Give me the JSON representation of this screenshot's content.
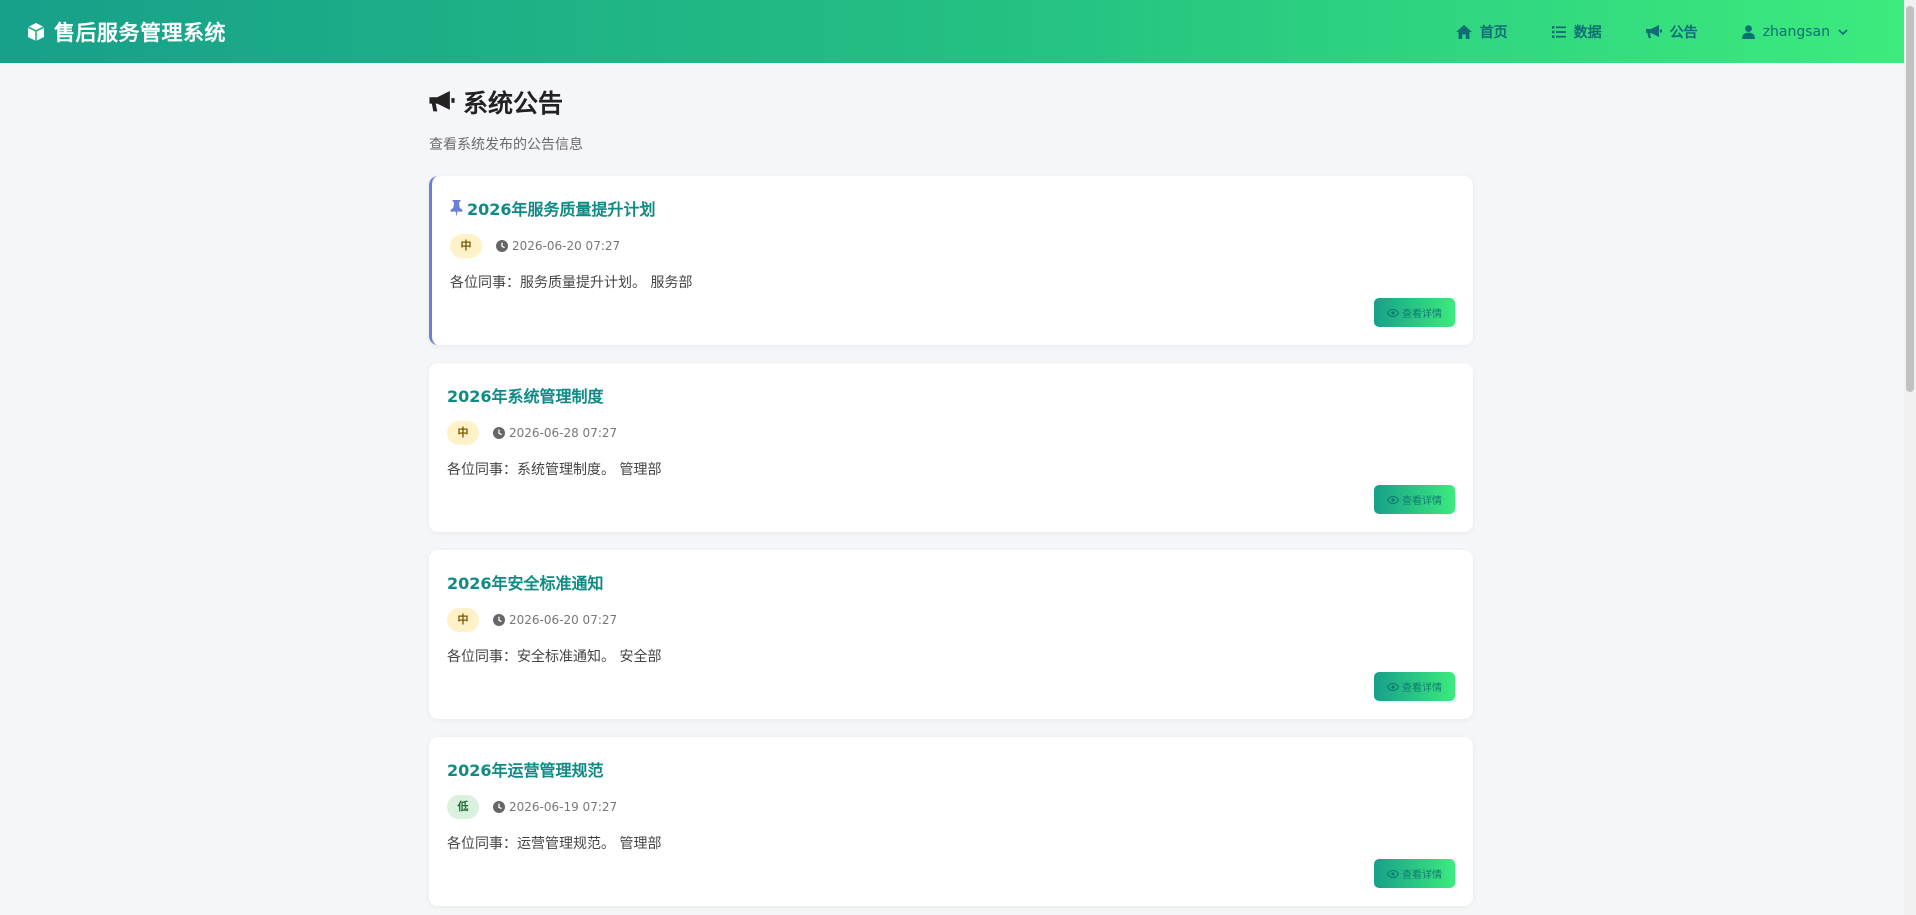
{
  "app": {
    "title": "售后服务管理系统"
  },
  "nav": {
    "home": "首页",
    "data": "数据",
    "announcement": "公告",
    "user": "zhangsan"
  },
  "page": {
    "title": "系统公告",
    "subtitle": "查看系统发布的公告信息"
  },
  "announcements": [
    {
      "title": "2026年服务质量提升计划",
      "pinned": true,
      "priority": "中",
      "priority_level": "medium",
      "date": "2026-06-20 07:27",
      "content": "各位同事：服务质量提升计划。 服务部",
      "button": "查看详情"
    },
    {
      "title": "2026年系统管理制度",
      "pinned": false,
      "priority": "中",
      "priority_level": "medium",
      "date": "2026-06-28 07:27",
      "content": "各位同事：系统管理制度。 管理部",
      "button": "查看详情"
    },
    {
      "title": "2026年安全标准通知",
      "pinned": false,
      "priority": "中",
      "priority_level": "medium",
      "date": "2026-06-20 07:27",
      "content": "各位同事：安全标准通知。 安全部",
      "button": "查看详情"
    },
    {
      "title": "2026年运营管理规范",
      "pinned": false,
      "priority": "低",
      "priority_level": "low",
      "date": "2026-06-19 07:27",
      "content": "各位同事：运营管理规范。 管理部",
      "button": "查看详情"
    }
  ],
  "colors": {
    "navbar_start": "#17a08a",
    "navbar_end": "#3ceb7d",
    "title_text": "#0f8a84",
    "pinned_border": "#6b7fd7",
    "badge_medium": "#fff2c8",
    "badge_low": "#d9f1de"
  }
}
